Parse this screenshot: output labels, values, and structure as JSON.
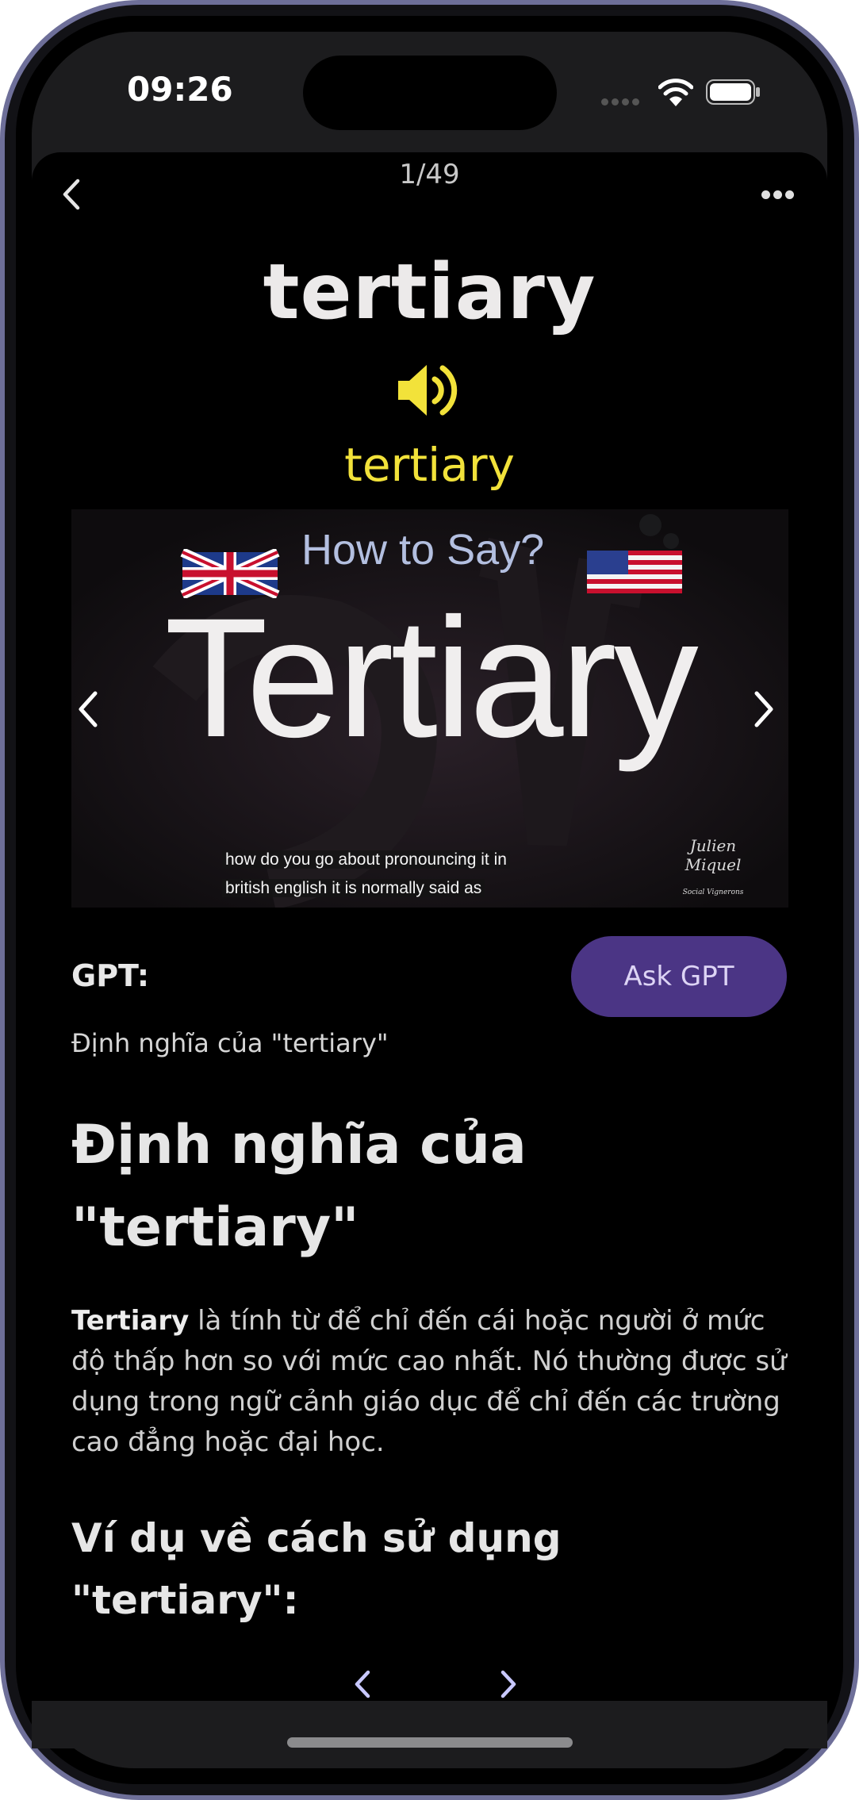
{
  "status": {
    "time": "09:26"
  },
  "header": {
    "counter": "1/49",
    "back_icon": "chevron-left-icon",
    "more_icon": "more-horizontal-icon"
  },
  "word": {
    "title": "tertiary",
    "phonetic": "tertiary",
    "speaker_icon": "speaker-icon",
    "accent_color": "#f2e23a"
  },
  "video": {
    "heading": "How to Say?",
    "word": "Tertiary",
    "caption_lines": [
      "how do you go about pronouncing it in",
      "british english it is normally said as"
    ],
    "signature": "Julien Miquel",
    "signature_sub": "Social Vignerons"
  },
  "gpt": {
    "label": "GPT:",
    "ask_button": "Ask GPT",
    "ask_button_color": "#4b3585",
    "summary": "Định nghĩa của \"tertiary\""
  },
  "content": {
    "heading": "Định nghĩa của \"tertiary\"",
    "paragraph_bold": "Tertiary",
    "paragraph_rest": " là tính từ để chỉ đến cái hoặc người ở mức độ thấp hơn so với mức cao nhất. Nó thường được sử dụng trong ngữ cảnh giáo dục để chỉ đến các trường cao đẳng hoặc đại học.",
    "subheading": "Ví dụ về cách sử dụng \"tertiary\":"
  },
  "pager": {
    "prev_icon": "chevron-left-icon",
    "next_icon": "chevron-right-icon"
  }
}
